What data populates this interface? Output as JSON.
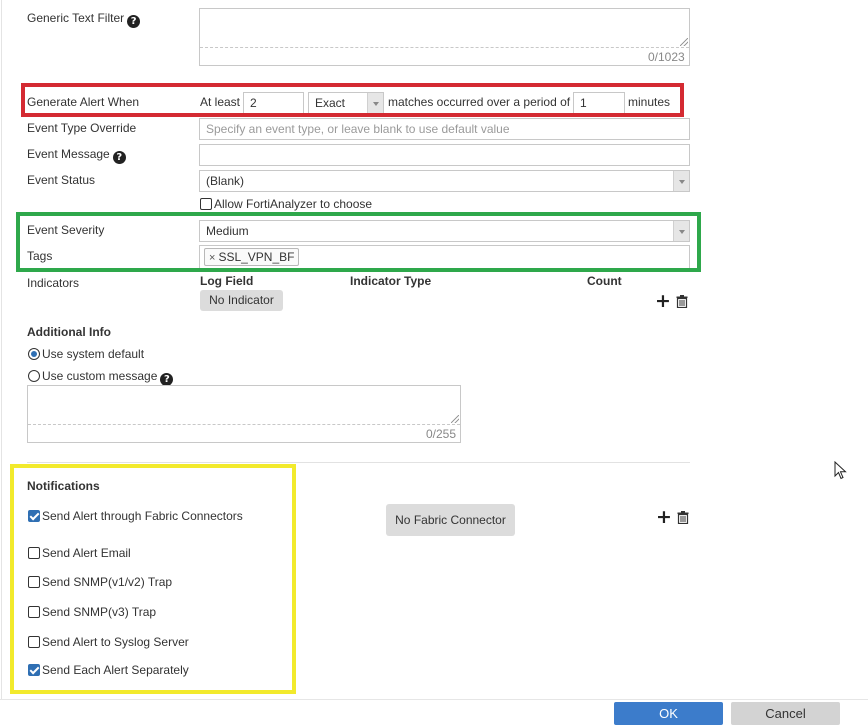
{
  "generic_filter": {
    "label": "Generic Text Filter",
    "counter": "0/1023"
  },
  "alert_when": {
    "label": "Generate Alert When",
    "prefix": "At least",
    "count_value": "2",
    "match_mode": "Exact",
    "middle_text": "matches occurred over a period of",
    "period_value": "1",
    "unit": "minutes"
  },
  "event_type": {
    "label": "Event Type Override",
    "placeholder": "Specify an event type, or leave blank to use default value"
  },
  "event_message": {
    "label": "Event Message"
  },
  "event_status": {
    "label": "Event Status",
    "value": "(Blank)",
    "allow_label": "Allow FortiAnalyzer to choose"
  },
  "event_severity": {
    "label": "Event Severity",
    "value": "Medium"
  },
  "tags": {
    "label": "Tags",
    "items": [
      "SSL_VPN_BF"
    ]
  },
  "indicators": {
    "label": "Indicators",
    "columns": [
      "Log Field",
      "Indicator Type",
      "Count"
    ],
    "empty_button": "No Indicator"
  },
  "additional_info": {
    "title": "Additional Info",
    "option_default": "Use system default",
    "option_custom": "Use custom message",
    "counter": "0/255"
  },
  "notifications": {
    "title": "Notifications",
    "fabric": "Send Alert through Fabric Connectors",
    "fabric_button": "No Fabric Connector",
    "email": "Send Alert Email",
    "snmp_v1v2": "Send SNMP(v1/v2) Trap",
    "snmp_v3": "Send SNMP(v3) Trap",
    "syslog": "Send Alert to Syslog Server",
    "separately": "Send Each Alert Separately"
  },
  "footer": {
    "ok": "OK",
    "cancel": "Cancel"
  },
  "colors": {
    "highlight_red": "#d42a32",
    "highlight_green": "#2ea84b",
    "highlight_yellow": "#f2ea2c",
    "primary_button": "#3c7ccb",
    "checkbox_checked": "#2f6fb3"
  }
}
